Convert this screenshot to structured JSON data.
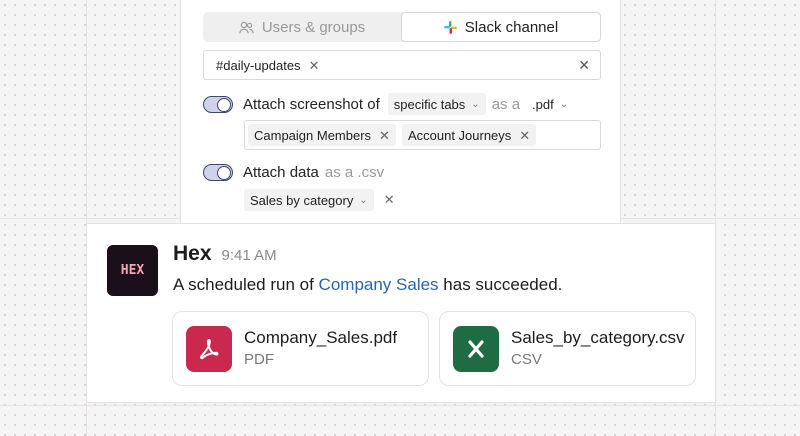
{
  "segment_tabs": [
    {
      "label": "Users & groups",
      "icon": "users-icon",
      "active": false
    },
    {
      "label": "Slack channel",
      "icon": "slack-icon",
      "active": true
    }
  ],
  "channel_field": {
    "value": "#daily-updates"
  },
  "screenshot_row": {
    "prefix": "Attach screenshot of",
    "scope": "specific tabs",
    "connector": "as a",
    "format": ".pdf",
    "tabs": [
      "Campaign Members",
      "Account Journeys"
    ],
    "enabled": true
  },
  "data_row": {
    "prefix": "Attach data",
    "suffix": "as a .csv",
    "dataset": "Sales by category",
    "enabled": true
  },
  "message": {
    "avatar_text": "HEX",
    "sender": "Hex",
    "time": "9:41 AM",
    "text_before": "A scheduled run of ",
    "link": "Company Sales",
    "text_after": " has succeeded.",
    "files": [
      {
        "name": "Company_Sales.pdf",
        "type": "PDF",
        "icon": "pdf-icon",
        "color": "#c8294d"
      },
      {
        "name": "Sales_by_category.csv",
        "type": "CSV",
        "icon": "excel-icon",
        "color": "#1f6b43"
      }
    ]
  },
  "colors": {
    "accent_link": "#2b65a8",
    "toggle_border": "#3d4670",
    "toggle_fill": "#cfd3ea"
  }
}
